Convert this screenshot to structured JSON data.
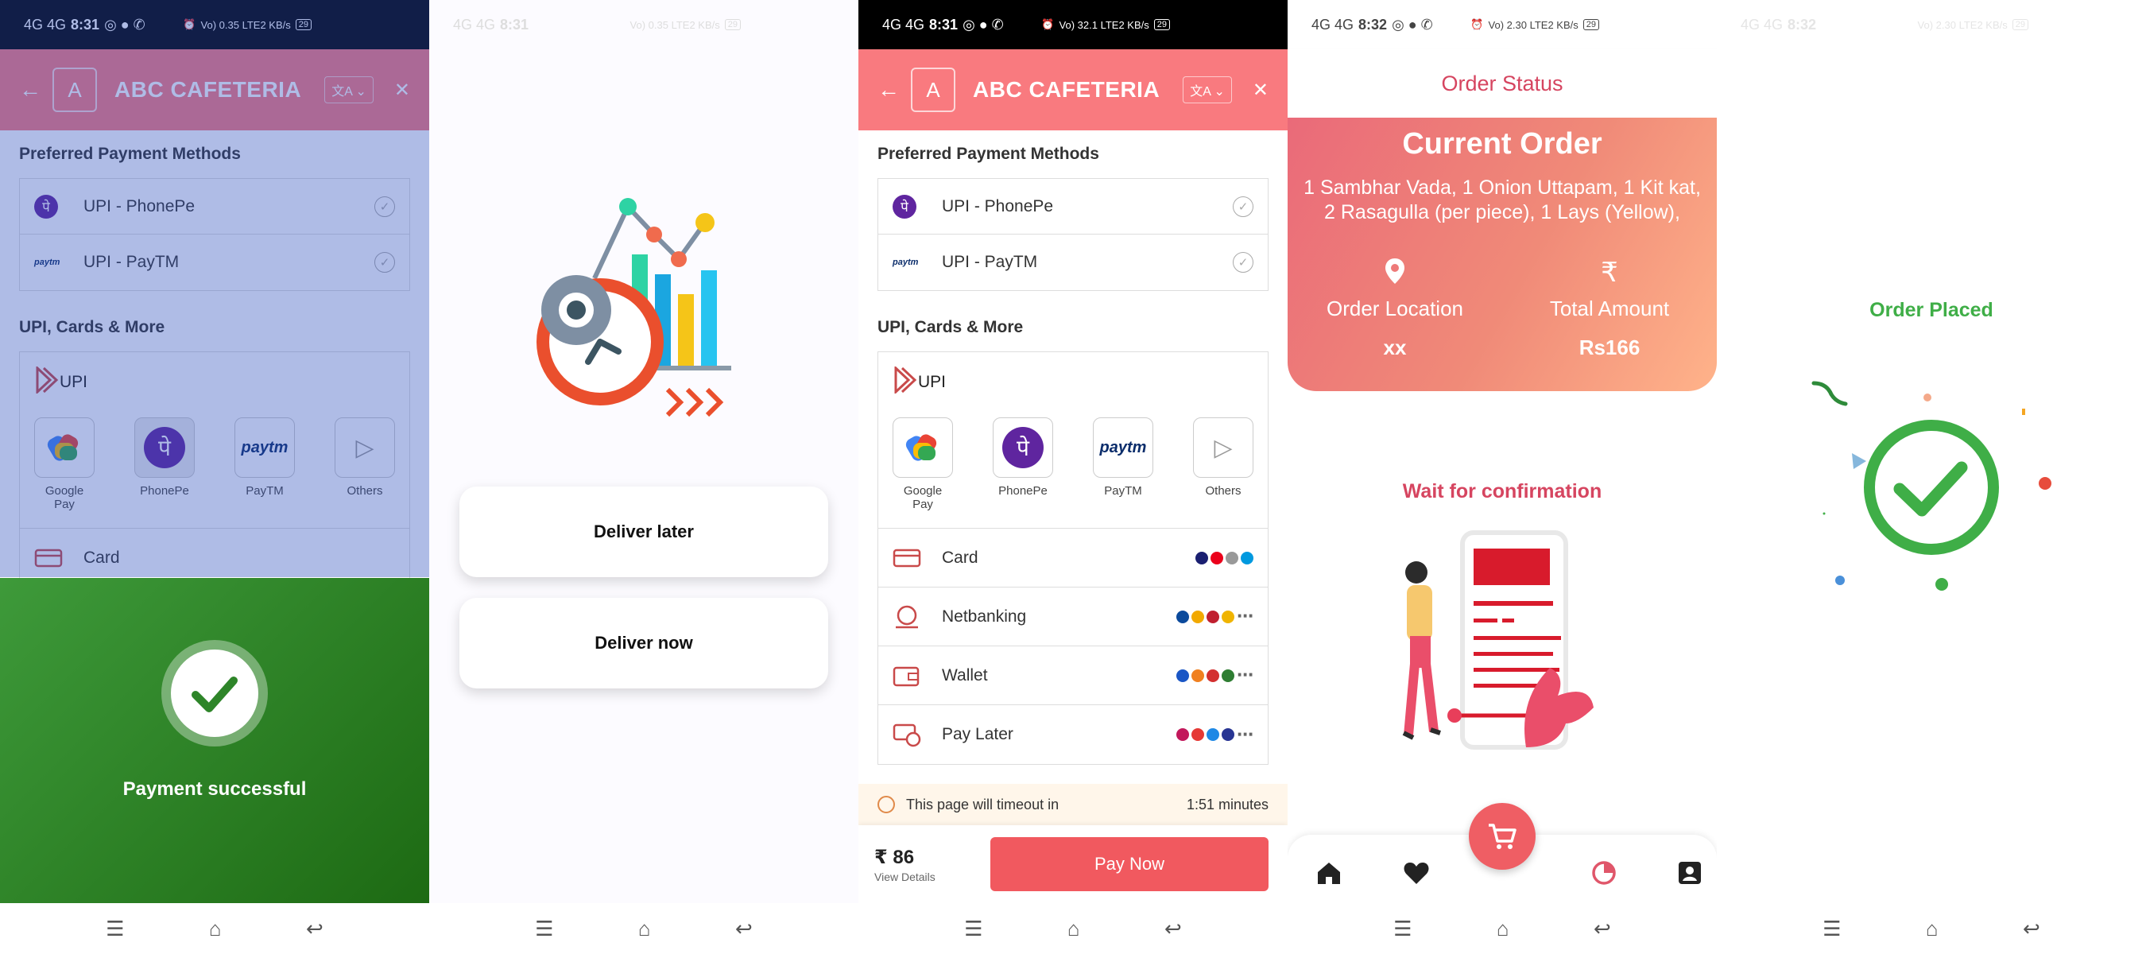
{
  "status_bar": {
    "s1": {
      "time": "8:31",
      "signal": "4G 4G",
      "speed": "Vo) 0.35 LTE2 KB/s",
      "battery": "29"
    },
    "s3": {
      "time": "8:31",
      "signal": "4G 4G",
      "speed": "Vo) 32.1 LTE2 KB/s",
      "battery": "29"
    },
    "s4": {
      "time": "8:32",
      "signal": "4G 4G",
      "speed": "Vo) 2.30 LTE2 KB/s",
      "battery": "29"
    }
  },
  "cafeteria": {
    "logo_letter": "A",
    "name": "ABC CAFETERIA",
    "lang_icon": "文A ⌄"
  },
  "payment": {
    "preferred_title": "Preferred Payment Methods",
    "preferred": [
      {
        "label": "UPI - PhonePe",
        "icon": "phonepe-icon"
      },
      {
        "label": "UPI - PayTM",
        "icon": "paytm-icon"
      }
    ],
    "more_title": "UPI, Cards & More",
    "upi_label": "UPI",
    "upi_apps": [
      "Google Pay",
      "PhonePe",
      "PayTM",
      "Others"
    ],
    "methods": [
      "Card",
      "Netbanking",
      "Wallet",
      "Pay Later"
    ],
    "timeout_label": "This page will timeout in",
    "timeout_value": "1:51 minutes",
    "amount": "₹ 86",
    "view_details": "View Details",
    "pay_button": "Pay Now"
  },
  "success": {
    "text": "Payment successful",
    "color": "#2e8529"
  },
  "delivery": {
    "later": "Deliver later",
    "now": "Deliver now"
  },
  "order_status": {
    "header": "Order Status",
    "current_title": "Current Order",
    "items_line1": "1 Sambhar Vada, 1 Onion Uttapam, 1 Kit kat,",
    "items_line2": "2 Rasagulla (per piece), 1 Lays (Yellow),",
    "location_label": "Order Location",
    "location_value": "xx",
    "total_label": "Total Amount",
    "total_value": "Rs166",
    "wait_text": "Wait for confirmation",
    "nav_icons": [
      "home-icon",
      "heart-icon",
      "cart-icon",
      "history-icon",
      "profile-icon"
    ]
  },
  "placed": {
    "text": "Order Placed",
    "color": "#3fae47"
  },
  "colors": {
    "accent": "#f97a7f",
    "pay_button": "#f1595f",
    "status_red": "#d64560",
    "success_green": "#3fae47"
  }
}
